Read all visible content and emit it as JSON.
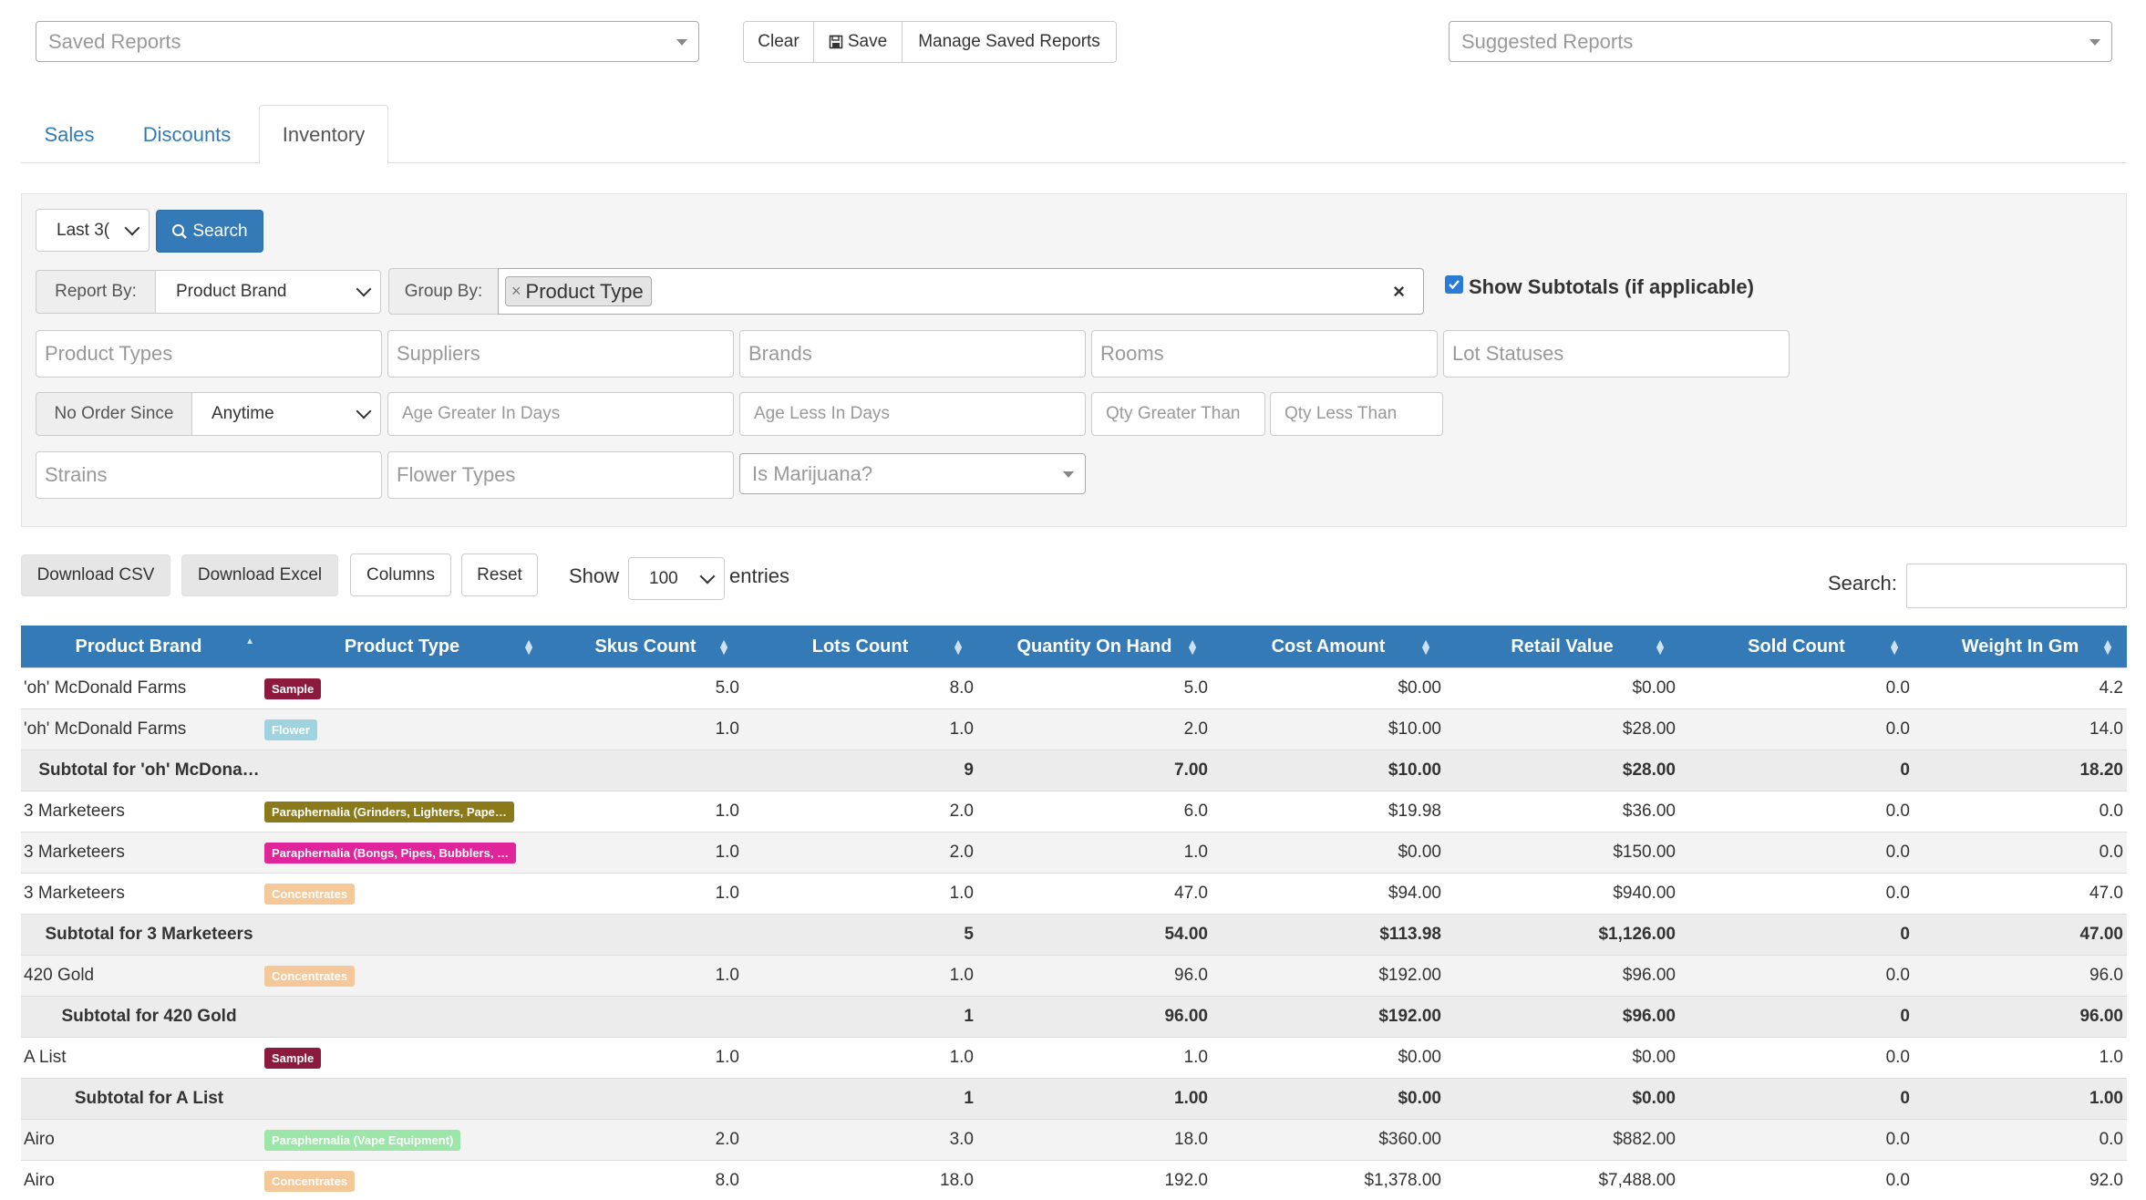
{
  "top": {
    "saved_reports_placeholder": "Saved Reports",
    "clear_label": "Clear",
    "save_label": "Save",
    "manage_label": "Manage Saved Reports",
    "suggested_placeholder": "Suggested Reports"
  },
  "tabs": [
    {
      "label": "Sales"
    },
    {
      "label": "Discounts"
    },
    {
      "label": "Inventory"
    }
  ],
  "filters": {
    "period_value": "Last 3(",
    "search_label": "Search",
    "report_by_label": "Report By:",
    "report_by_value": "Product Brand",
    "group_by_label": "Group By:",
    "group_by_tag": "Product Type",
    "show_subtotals_label": "Show Subtotals (if applicable)",
    "product_types_placeholder": "Product Types",
    "suppliers_placeholder": "Suppliers",
    "brands_placeholder": "Brands",
    "rooms_placeholder": "Rooms",
    "lot_statuses_placeholder": "Lot Statuses",
    "no_order_since_label": "No Order Since",
    "no_order_since_value": "Anytime",
    "age_greater_placeholder": "Age Greater In Days",
    "age_less_placeholder": "Age Less In Days",
    "qty_greater_placeholder": "Qty Greater Than",
    "qty_less_placeholder": "Qty Less Than",
    "strains_placeholder": "Strains",
    "flower_types_placeholder": "Flower Types",
    "is_marijuana_placeholder": "Is Marijuana?"
  },
  "toolbar": {
    "download_csv": "Download CSV",
    "download_excel": "Download Excel",
    "columns": "Columns",
    "reset": "Reset",
    "show": "Show",
    "entries_value": "100",
    "entries": "entries",
    "search_label": "Search:"
  },
  "table": {
    "headers": [
      "Product Brand",
      "Product Type",
      "Skus Count",
      "Lots Count",
      "Quantity On Hand",
      "Cost Amount",
      "Retail Value",
      "Sold Count",
      "Weight In Gm"
    ],
    "rows": [
      {
        "kind": "data",
        "brand": "'oh' McDonald Farms",
        "type": "Sample",
        "color": "#8b1a3e",
        "skus": "5.0",
        "lots": "8.0",
        "qty": "5.0",
        "cost": "$0.00",
        "retail": "$0.00",
        "sold": "0.0",
        "weight": "4.2"
      },
      {
        "kind": "data",
        "brand": "'oh' McDonald Farms",
        "type": "Flower",
        "color": "#9fd3e0",
        "skus": "1.0",
        "lots": "1.0",
        "qty": "2.0",
        "cost": "$10.00",
        "retail": "$28.00",
        "sold": "0.0",
        "weight": "14.0"
      },
      {
        "kind": "sub",
        "brand": "Subtotal for 'oh' McDona…",
        "type": "",
        "skus": "",
        "lots": "9",
        "qty": "7.00",
        "cost": "$10.00",
        "retail": "$28.00",
        "sold": "0",
        "weight": "18.20"
      },
      {
        "kind": "data",
        "brand": "3 Marketeers",
        "type": "Paraphernalia (Grinders, Lighters, Pape…",
        "color": "#8b7a1a",
        "skus": "1.0",
        "lots": "2.0",
        "qty": "6.0",
        "cost": "$19.98",
        "retail": "$36.00",
        "sold": "0.0",
        "weight": "0.0"
      },
      {
        "kind": "data",
        "brand": "3 Marketeers",
        "type": "Paraphernalia (Bongs, Pipes, Bubblers, …",
        "color": "#e0249a",
        "skus": "1.0",
        "lots": "2.0",
        "qty": "1.0",
        "cost": "$0.00",
        "retail": "$150.00",
        "sold": "0.0",
        "weight": "0.0"
      },
      {
        "kind": "data",
        "brand": "3 Marketeers",
        "type": "Concentrates",
        "color": "#f5c89a",
        "skus": "1.0",
        "lots": "1.0",
        "qty": "47.0",
        "cost": "$94.00",
        "retail": "$940.00",
        "sold": "0.0",
        "weight": "47.0"
      },
      {
        "kind": "sub",
        "brand": "Subtotal for 3 Marketeers",
        "type": "",
        "skus": "",
        "lots": "5",
        "qty": "54.00",
        "cost": "$113.98",
        "retail": "$1,126.00",
        "sold": "0",
        "weight": "47.00"
      },
      {
        "kind": "data",
        "brand": "420 Gold",
        "type": "Concentrates",
        "color": "#f5c89a",
        "skus": "1.0",
        "lots": "1.0",
        "qty": "96.0",
        "cost": "$192.00",
        "retail": "$96.00",
        "sold": "0.0",
        "weight": "96.0"
      },
      {
        "kind": "sub",
        "brand": "Subtotal for 420 Gold",
        "type": "",
        "skus": "",
        "lots": "1",
        "qty": "96.00",
        "cost": "$192.00",
        "retail": "$96.00",
        "sold": "0",
        "weight": "96.00"
      },
      {
        "kind": "data",
        "brand": "A List",
        "type": "Sample",
        "color": "#8b1a3e",
        "skus": "1.0",
        "lots": "1.0",
        "qty": "1.0",
        "cost": "$0.00",
        "retail": "$0.00",
        "sold": "0.0",
        "weight": "1.0"
      },
      {
        "kind": "sub",
        "brand": "Subtotal for A List",
        "type": "",
        "skus": "",
        "lots": "1",
        "qty": "1.00",
        "cost": "$0.00",
        "retail": "$0.00",
        "sold": "0",
        "weight": "1.00"
      },
      {
        "kind": "data",
        "brand": "Airo",
        "type": "Paraphernalia (Vape Equipment)",
        "color": "#9be6a8",
        "skus": "2.0",
        "lots": "3.0",
        "qty": "18.0",
        "cost": "$360.00",
        "retail": "$882.00",
        "sold": "0.0",
        "weight": "0.0"
      },
      {
        "kind": "data",
        "brand": "Airo",
        "type": "Concentrates",
        "color": "#f5c89a",
        "skus": "8.0",
        "lots": "18.0",
        "qty": "192.0",
        "cost": "$1,378.00",
        "retail": "$7,488.00",
        "sold": "0.0",
        "weight": "92.0"
      }
    ]
  }
}
